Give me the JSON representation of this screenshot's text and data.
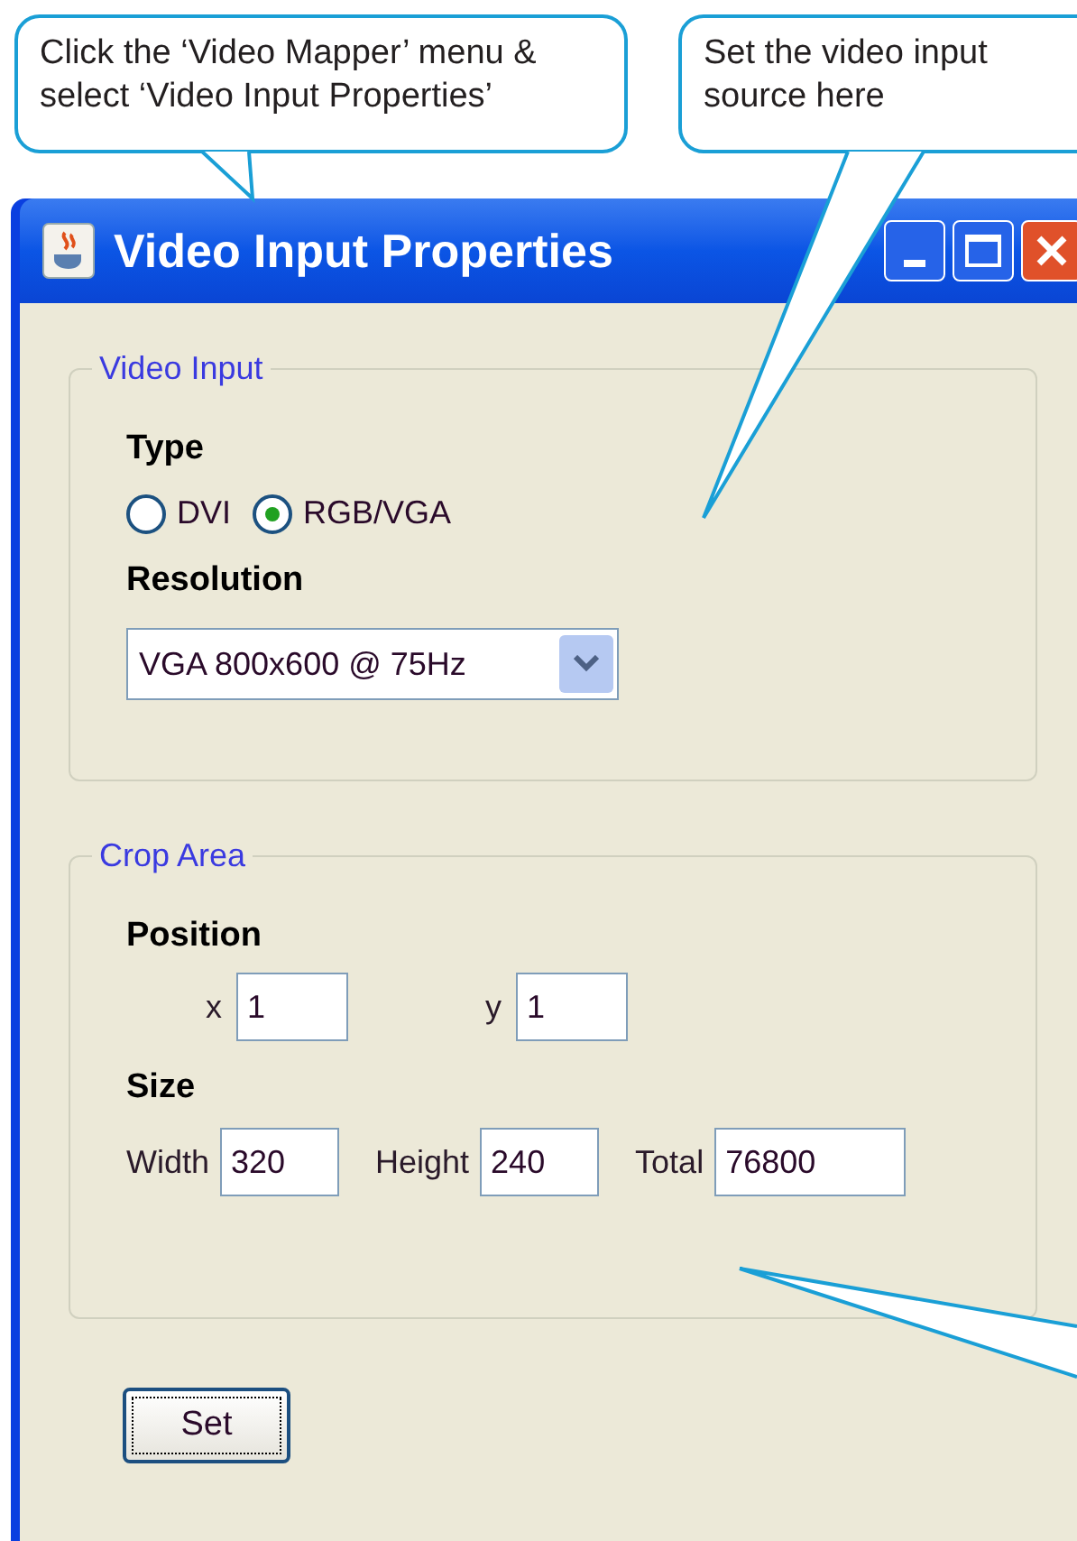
{
  "callouts": [
    {
      "text": "Click the ‘Video Mapper’ menu & select ‘Video Input Properties’"
    },
    {
      "text": "Set the video input source here"
    }
  ],
  "window": {
    "title": "Video Input Properties"
  },
  "video_input": {
    "legend": "Video Input",
    "type_label": "Type",
    "types": [
      {
        "label": "DVI",
        "selected": false
      },
      {
        "label": "RGB/VGA",
        "selected": true
      }
    ],
    "resolution_label": "Resolution",
    "resolution": "VGA 800x600 @ 75Hz"
  },
  "crop_area": {
    "legend": "Crop Area",
    "position_label": "Position",
    "position": [
      {
        "label": "x",
        "value": "1"
      },
      {
        "label": "y",
        "value": "1"
      }
    ],
    "size_label": "Size",
    "size": [
      {
        "label": "Width",
        "value": "320"
      },
      {
        "label": "Height",
        "value": "240"
      },
      {
        "label": "Total",
        "value": "76800"
      }
    ]
  },
  "set_button": "Set"
}
